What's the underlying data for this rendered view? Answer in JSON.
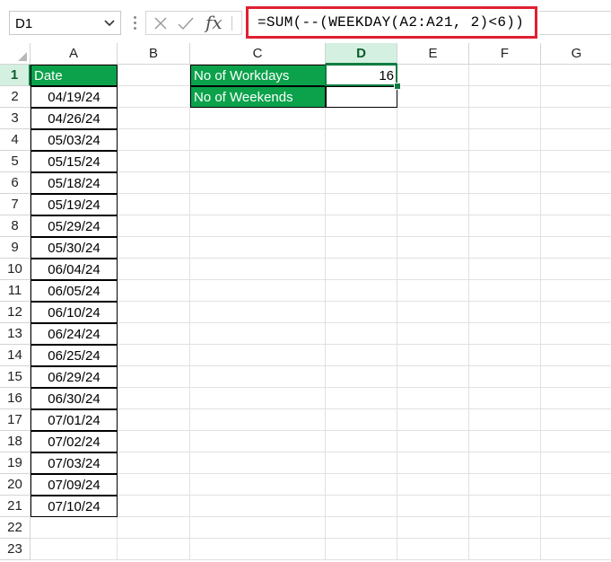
{
  "formula_bar": {
    "name_box": "D1",
    "fx_label": "fx",
    "formula": "=SUM(--(WEEKDAY(A2:A21, 2)<6))"
  },
  "columns": [
    "A",
    "B",
    "C",
    "D",
    "E",
    "F",
    "G"
  ],
  "rows": [
    "1",
    "2",
    "3",
    "4",
    "5",
    "6",
    "7",
    "8",
    "9",
    "10",
    "11",
    "12",
    "13",
    "14",
    "15",
    "16",
    "17",
    "18",
    "19",
    "20",
    "21",
    "22",
    "23"
  ],
  "cells": {
    "A1": "Date",
    "dates": [
      "04/19/24",
      "04/26/24",
      "05/03/24",
      "05/15/24",
      "05/18/24",
      "05/19/24",
      "05/29/24",
      "05/30/24",
      "06/04/24",
      "06/05/24",
      "06/10/24",
      "06/24/24",
      "06/25/24",
      "06/29/24",
      "06/30/24",
      "07/01/24",
      "07/02/24",
      "07/03/24",
      "07/09/24",
      "07/10/24"
    ],
    "C1": "No of Workdays",
    "C2": "No of Weekends",
    "D1": "16",
    "D2": ""
  },
  "colors": {
    "header_fill": "#0ba24b",
    "selection_accent": "#107c41",
    "formula_highlight": "#e02030"
  }
}
